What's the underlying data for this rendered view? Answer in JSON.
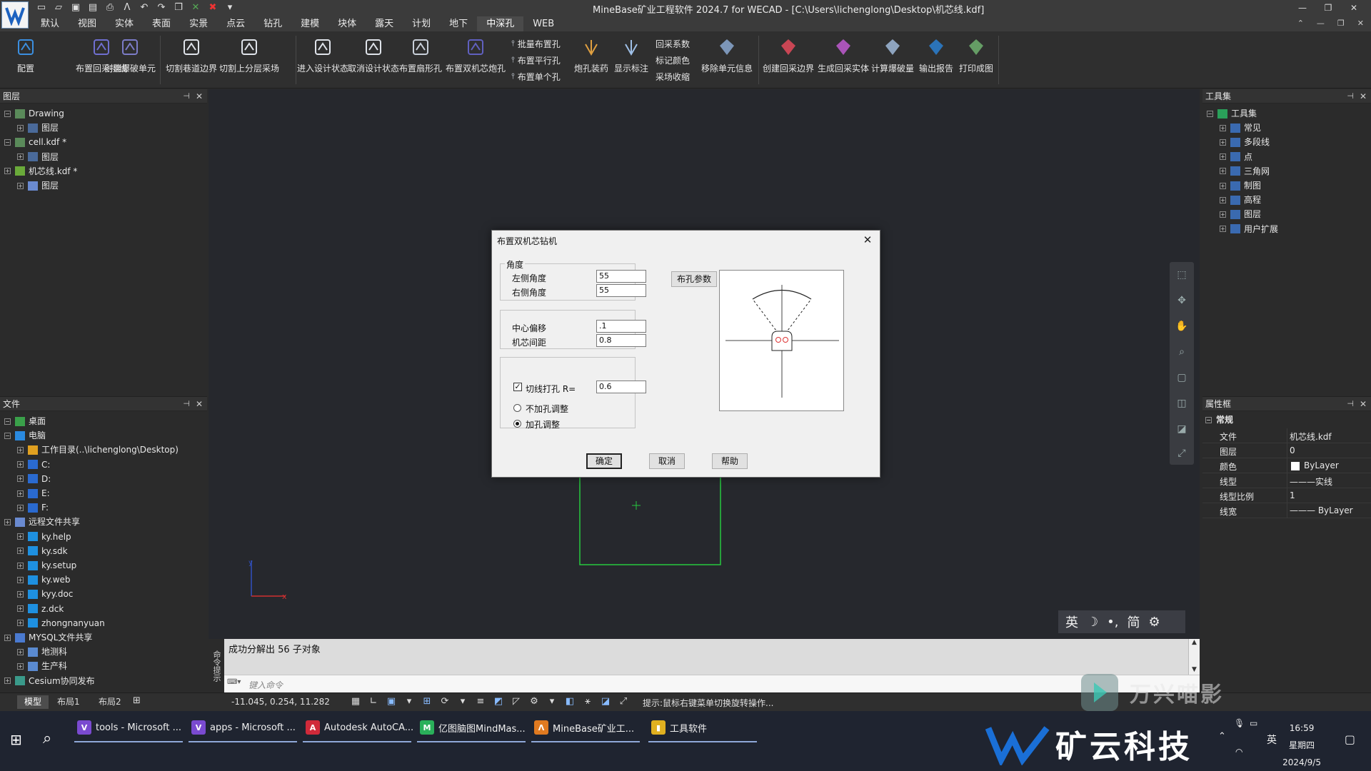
{
  "window": {
    "title": "MineBase矿业工程软件 2024.7 for WECAD  - [C:\\Users\\lichenglong\\Desktop\\机芯线.kdf]"
  },
  "menu": [
    "默认",
    "视图",
    "实体",
    "表面",
    "实景",
    "点云",
    "钻孔",
    "建模",
    "块体",
    "露天",
    "计划",
    "地下",
    "中深孔",
    "WEB"
  ],
  "menu_active_index": 12,
  "ribbon": {
    "large": [
      "配置",
      "布置回采排线",
      "创建爆破单元",
      "切割巷道边界",
      "切割上分层采场",
      "进入设计状态",
      "取消设计状态",
      "布置扇形孔",
      "布置双机芯炮孔"
    ],
    "small_col1": [
      "批量布置孔",
      "布置平行孔",
      "布置单个孔"
    ],
    "large2": [
      "炮孔装药",
      "显示标注"
    ],
    "small_col2": [
      "回采系数",
      "标记颜色",
      "采场收缩"
    ],
    "large3": [
      "移除单元信息",
      "创建回采边界",
      "生成回采实体",
      "计算爆破量",
      "输出报告",
      "打印成图"
    ]
  },
  "layers_panel": {
    "title": "图层",
    "items": [
      "Drawing",
      "图层",
      "cell.kdf *",
      "图层",
      "机芯线.kdf *",
      "图层"
    ]
  },
  "file_panel": {
    "title": "文件",
    "items": [
      "桌面",
      "电脑",
      "工作目录(..\\lichenglong\\Desktop)",
      "C:",
      "D:",
      "E:",
      "F:",
      "远程文件共享",
      "ky.help",
      "ky.sdk",
      "ky.setup",
      "ky.web",
      "kyy.doc",
      "z.dck",
      "zhongnanyuan",
      "MYSQL文件共享",
      "地测科",
      "生产科",
      "Cesium协同发布"
    ]
  },
  "toolset_panel": {
    "title": "工具集",
    "items": [
      "工具集",
      "常见",
      "多段线",
      "点",
      "三角网",
      "制图",
      "高程",
      "图层",
      "用户扩展"
    ]
  },
  "props_panel": {
    "title": "属性框",
    "group": "常规",
    "rows": [
      {
        "k": "文件",
        "v": "机芯线.kdf"
      },
      {
        "k": "图层",
        "v": "0"
      },
      {
        "k": "颜色",
        "v": "ByLayer"
      },
      {
        "k": "线型",
        "v": "———实线"
      },
      {
        "k": "线型比例",
        "v": "1"
      },
      {
        "k": "线宽",
        "v": "——— ByLayer"
      }
    ]
  },
  "command": {
    "label": "命令提示",
    "output": "成功分解出  56  子对象",
    "placeholder": "键入命令"
  },
  "layouts": [
    "模型",
    "布局1",
    "布局2"
  ],
  "status": {
    "coords": "-11.045, 0.254, 11.282",
    "hint": "提示:鼠标右键菜单切换旋转操作..."
  },
  "dialog": {
    "title": "布置双机芯钻机",
    "angle_group": "角度",
    "left_angle_label": "左侧角度",
    "left_angle": "55",
    "right_angle_label": "右侧角度",
    "right_angle": "55",
    "params_button": "布孔参数",
    "center_offset_label": "中心偏移",
    "center_offset": ".1",
    "core_spacing_label": "机芯间距",
    "core_spacing": "0.8",
    "cut_hole_label": "切线打孔 R=",
    "cut_hole_value": "0.6",
    "cut_hole_checked": true,
    "radio_no_adjust": "不加孔调整",
    "radio_adjust": "加孔调整",
    "ok": "确定",
    "cancel": "取消",
    "help": "帮助"
  },
  "ime": [
    "英",
    "简"
  ],
  "taskbar": {
    "tasks": [
      "tools - Microsoft ...",
      "apps - Microsoft ...",
      "Autodesk AutoCA...",
      "亿图脑图MindMas...",
      "MineBase矿业工...",
      "工具软件"
    ],
    "lang": "英",
    "time": "16:59",
    "weekday": "星期四",
    "date": "2024/9/5"
  },
  "watermark": {
    "top": "万兴喵影",
    "brand": "矿云科技"
  },
  "colors": {
    "canvas_bg": "#26282d",
    "shape_green": "#27c93f",
    "axis_red": "#d03030",
    "axis_blue": "#3050c0"
  }
}
